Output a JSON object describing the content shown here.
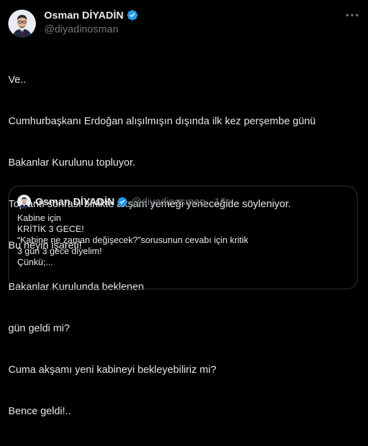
{
  "colors": {
    "background": "#000000",
    "text": "#e7e9ea",
    "muted": "#71767b",
    "verified": "#1d9bf0",
    "border": "#2f3336"
  },
  "author": {
    "name": "Osman DİYADİN",
    "handle": "@diyadinosman",
    "avatar_icon": "avatar",
    "verified_icon": "verified-badge-icon"
  },
  "more_icon": "more-options-icon",
  "tweet": {
    "lines": [
      "Ve..",
      "Cumhurbaşkanı Erdoğan alışılmışın dışında ilk kez perşembe günü",
      "Bakanlar Kurulunu topluyor.",
      "Toplantı sonrası birlikte akşam yemeği yeneceğide söyleniyor.",
      "Bu neyin işareti!",
      "Bakanlar Kurulunda beklenen",
      "gün geldi mi?",
      "Cuma akşamı yeni kabineyi bekleyebiliriz mi?",
      "Bence geldi!.."
    ]
  },
  "quote": {
    "name": "Osman DİYADİN",
    "handle": "@diyadinosman",
    "separator": "·",
    "time": "16s",
    "lines": [
      "Kabine için",
      "KRİTİK 3 GECE!",
      "“Kabine ne zaman değişecek?”sorusunun cevabı için kritik",
      "3 gün 3 gece diyelim!",
      "Çünkü;..."
    ]
  }
}
